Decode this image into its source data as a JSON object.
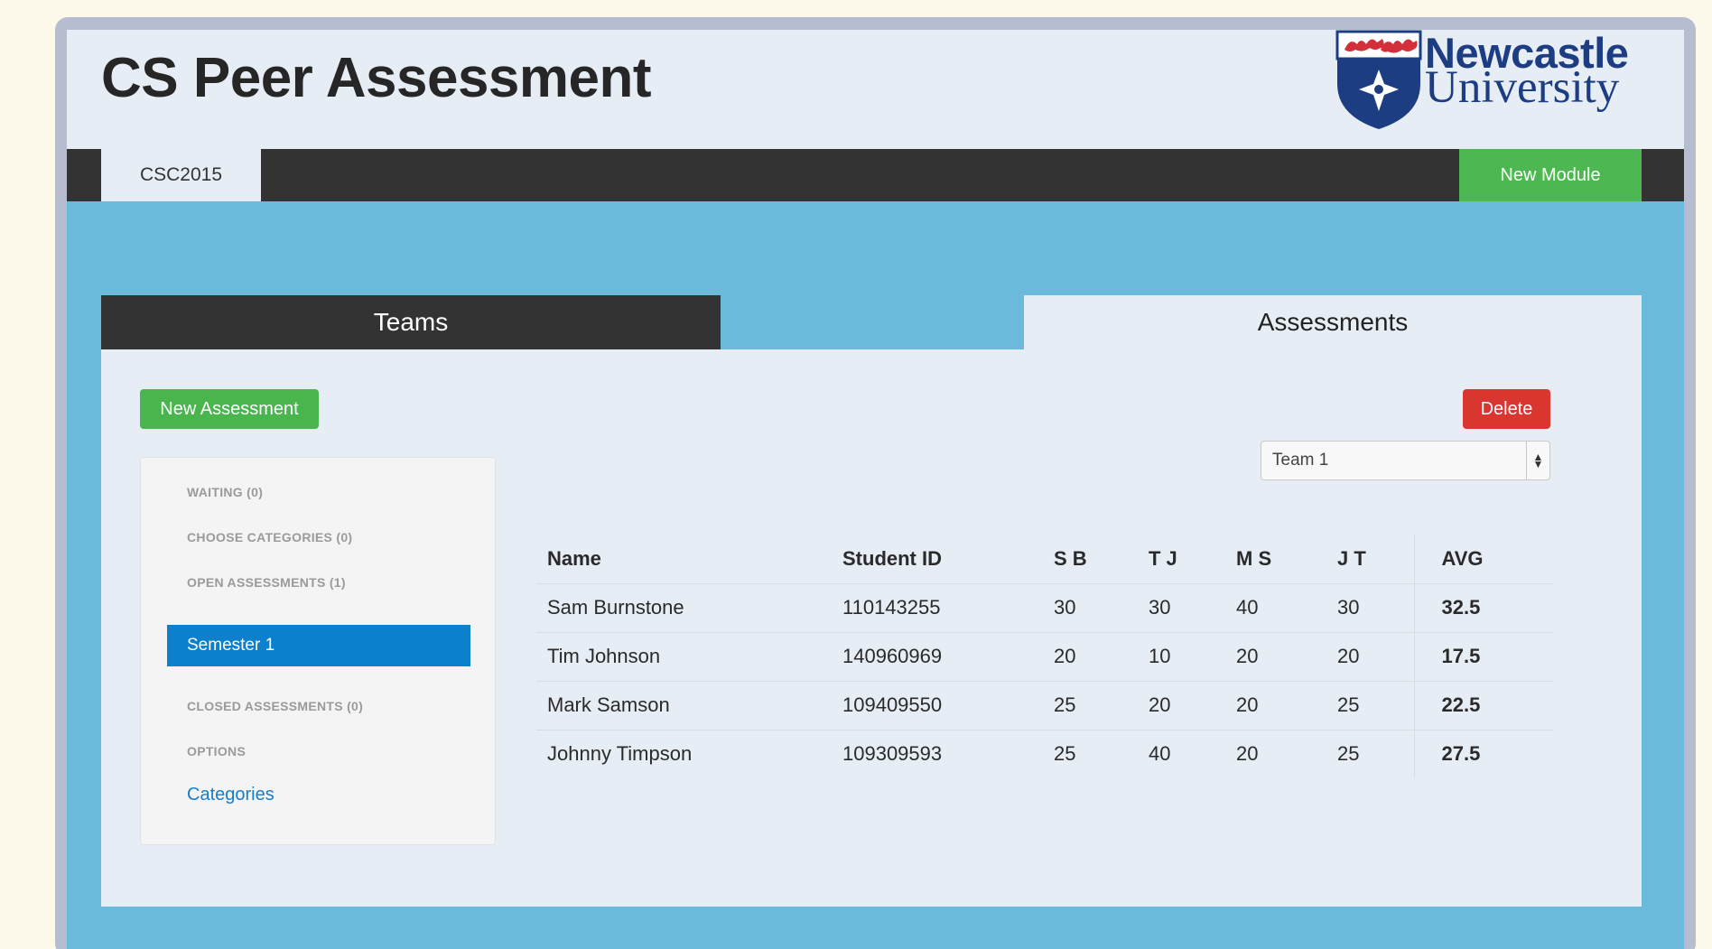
{
  "header": {
    "title": "CS Peer Assessment",
    "logo": {
      "line1": "Newcastle",
      "line2": "University"
    }
  },
  "navbar": {
    "module_tab": "CSC2015",
    "new_module_label": "New Module"
  },
  "tabs": {
    "teams": "Teams",
    "assessments": "Assessments"
  },
  "panel": {
    "new_assessment_label": "New Assessment",
    "delete_label": "Delete",
    "team_select": {
      "selected": "Team 1"
    }
  },
  "sidebar": {
    "waiting": "WAITING (0)",
    "choose_categories": "CHOOSE CATEGORIES (0)",
    "open_assessments": "OPEN ASSESSMENTS (1)",
    "active_item": "Semester 1",
    "closed_assessments": "CLOSED ASSESSMENTS (0)",
    "options": "OPTIONS",
    "categories_link": "Categories"
  },
  "table": {
    "headers": [
      "Name",
      "Student ID",
      "S B",
      "T J",
      "M S",
      "J T",
      "AVG"
    ],
    "rows": [
      [
        "Sam Burnstone",
        "110143255",
        "30",
        "30",
        "40",
        "30",
        "32.5"
      ],
      [
        "Tim Johnson",
        "140960969",
        "20",
        "10",
        "20",
        "20",
        "17.5"
      ],
      [
        "Mark Samson",
        "109409550",
        "25",
        "20",
        "20",
        "25",
        "22.5"
      ],
      [
        "Johnny Timpson",
        "109309593",
        "25",
        "40",
        "20",
        "25",
        "27.5"
      ]
    ]
  },
  "colors": {
    "app_background": "#6bbadb",
    "panel": "#e7edf5",
    "navbar": "#333333",
    "green": "#48b54d",
    "red": "#da3630",
    "active_blue": "#0c7fcd",
    "logo_blue": "#1d3d83",
    "logo_red": "#d32f3a"
  }
}
